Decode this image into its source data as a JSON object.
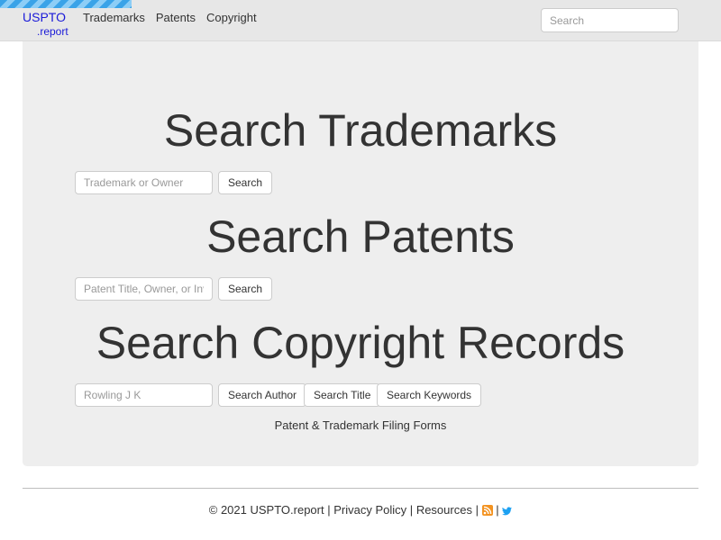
{
  "brand": {
    "name": "USPTO",
    "suffix": ".report"
  },
  "nav": {
    "items": [
      {
        "label": "Trademarks"
      },
      {
        "label": "Patents"
      },
      {
        "label": "Copyright"
      }
    ]
  },
  "nav_search": {
    "placeholder": "Search"
  },
  "trademarks": {
    "heading": "Search Trademarks",
    "placeholder": "Trademark or Owner",
    "button": "Search"
  },
  "patents": {
    "heading": "Search Patents",
    "placeholder": "Patent Title, Owner, or Inventor",
    "button": "Search"
  },
  "copyright": {
    "heading": "Search Copyright Records",
    "placeholder": "Rowling J K",
    "buttons": {
      "author": "Search Author",
      "title": "Search Title",
      "keywords": "Search Keywords"
    }
  },
  "forms_link": "Patent & Trademark Filing Forms",
  "footer": {
    "copyright": "© 2021 USPTO.report",
    "sep": "|",
    "privacy": "Privacy Policy",
    "resources": "Resources",
    "icons": {
      "rss": "rss-icon",
      "twitter": "twitter-icon"
    },
    "colors": {
      "rss": "#f39321",
      "twitter": "#1da1f2"
    }
  }
}
